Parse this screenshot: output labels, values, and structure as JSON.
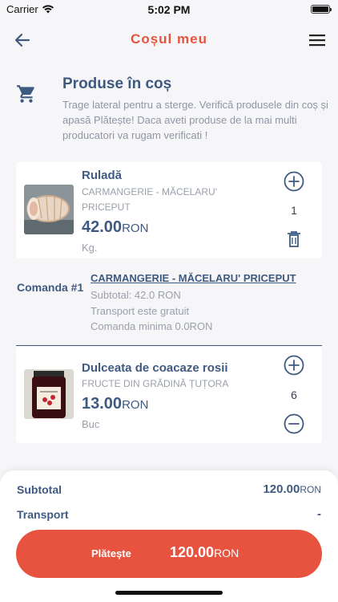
{
  "status_bar": {
    "carrier": "Carrier",
    "time": "5:02 PM"
  },
  "header": {
    "title": "Coșul meu",
    "back_icon": "arrow-left-icon",
    "menu_icon": "hamburger-menu-icon"
  },
  "intro": {
    "icon": "cart-icon",
    "title": "Produse în coș",
    "text": "Trage lateral pentru a sterge. Verifică produsele din coș și apasă Plătește! Daca aveti produse de la mai multi producatori va rugam verificati !"
  },
  "products": [
    {
      "name": "Ruladă",
      "producer": "CARMANGERIE - MĂCELARU' PRICEPUT",
      "price": "42.00",
      "currency": "RON",
      "unit": "Kg.",
      "quantity": "1",
      "actions": [
        "plus-circle-icon",
        "trash-icon"
      ]
    },
    {
      "name": "Dulceata de coacaze rosii",
      "producer": "FRUCTE DIN GRĂDINĂ ȚUȚORA",
      "price": "13.00",
      "currency": "RON",
      "unit": "Buc",
      "quantity": "6",
      "actions": [
        "plus-circle-icon",
        "minus-circle-icon"
      ]
    }
  ],
  "order": {
    "label": "Comanda #1",
    "producer": "CARMANGERIE - MĂCELARU' PRICEPUT",
    "subtotal": "Subtotal: 42.0 RON",
    "transport": "Transport  este gratuit",
    "minimum": "Comanda minima 0.0RON"
  },
  "summary": {
    "subtotal_label": "Subtotal",
    "subtotal_value": "120.00",
    "subtotal_currency": "RON",
    "transport_label": "Transport",
    "transport_value": "-"
  },
  "pay_button": {
    "label": "Plătește",
    "total": "120.00",
    "currency": "RON"
  },
  "colors": {
    "accent": "#e8533f",
    "primary": "#3f5a80",
    "muted": "#9aa0ab",
    "background": "#f6f6f8"
  }
}
